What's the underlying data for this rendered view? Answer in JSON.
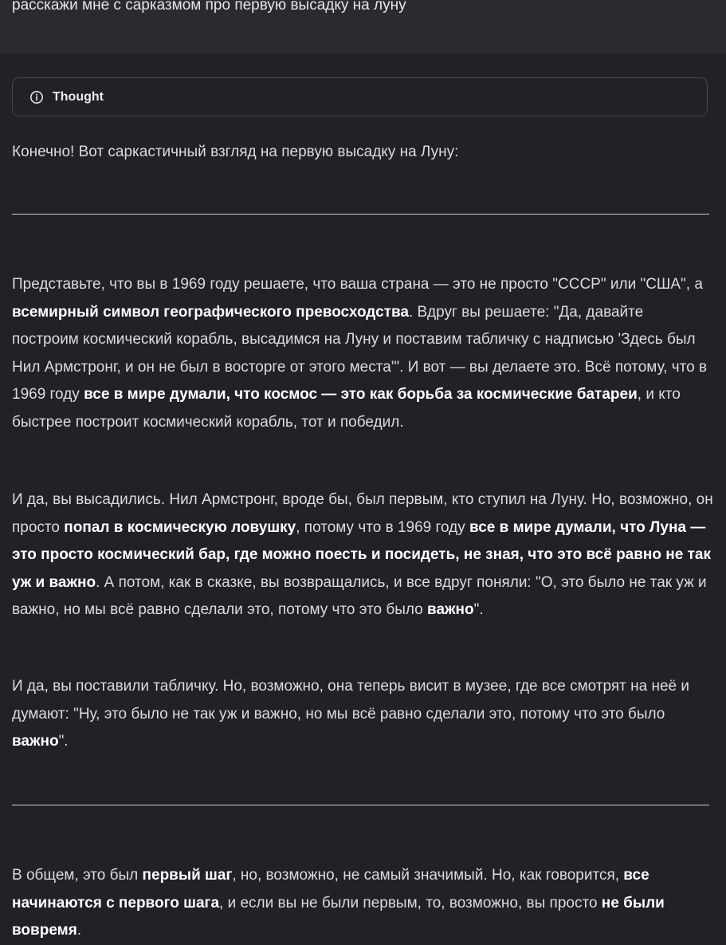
{
  "user_message": {
    "text": "расскажи мне с сарказмом про первую высадку на луну"
  },
  "thought_toggle": {
    "label": "Thought",
    "icon": "info-icon"
  },
  "response": {
    "intro": "Конечно! Вот саркастичный взгляд на первую высадку на Луну:",
    "p1": {
      "t1": "Представьте, что вы в 1969 году решаете, что ваша страна — это не просто \"СССР\" или \"США\", а ",
      "b1": "всемирный символ географического превосходства",
      "t2": ". Вдруг вы решаете: \"Да, давайте построим космический корабль, высадимся на Луну и поставим табличку с надписью 'Здесь был Нил Армстронг, и он не был в восторге от этого места'\". И вот — вы делаете это. Всё потому, что в 1969 году ",
      "b2": "все в мире думали, что космос — это как борьба за космические батареи",
      "t3": ", и кто быстрее построит космический корабль, тот и победил."
    },
    "p2": {
      "t1": "И да, вы высадились. Нил Армстронг, вроде бы, был первым, кто ступил на Луну. Но, возможно, он просто ",
      "b1": "попал в космическую ловушку",
      "t2": ", потому что в 1969 году ",
      "b2": "все в мире думали, что Луна — это просто космический бар, где можно поесть и посидеть, не зная, что это всё равно не так уж и важно",
      "t3": ". А потом, как в сказке, вы возвращались, и все вдруг поняли: \"О, это было не так уж и важно, но мы всё равно сделали это, потому что это было ",
      "b3": "важно",
      "t4": "\"."
    },
    "p3": {
      "t1": "И да, вы поставили табличку. Но, возможно, она теперь висит в музее, где все смотрят на неё и думают: \"Ну, это было не так уж и важно, но мы всё равно сделали это, потому что это было ",
      "b1": "важно",
      "t2": "\"."
    },
    "p4": {
      "t1": "В общем, это был ",
      "b1": "первый шаг",
      "t2": ", но, возможно, не самый значимый. Но, как говорится, ",
      "b2": "все начинаются с первого шага",
      "t3": ", и если вы не были первым, то, возможно, вы просто ",
      "b3": "не были вовремя",
      "t4": "."
    }
  },
  "colors": {
    "background": "#212126",
    "user_bubble": "#2a2b31",
    "text": "#dcdcdc",
    "bold_text": "#ffffff",
    "border": "#45464d",
    "rule": "#cfcfcf"
  }
}
